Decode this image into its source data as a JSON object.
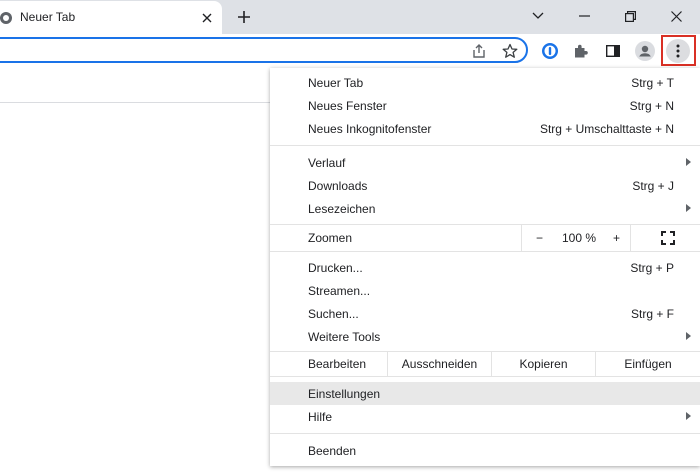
{
  "tab": {
    "title": "Neuer Tab"
  },
  "menu": {
    "items_group1": [
      {
        "label": "Neuer Tab",
        "shortcut": "Strg + T"
      },
      {
        "label": "Neues Fenster",
        "shortcut": "Strg + N"
      },
      {
        "label": "Neues Inkognitofenster",
        "shortcut": "Strg + Umschalttaste + N"
      }
    ],
    "items_group2": [
      {
        "label": "Verlauf",
        "shortcut": ""
      },
      {
        "label": "Downloads",
        "shortcut": "Strg + J"
      },
      {
        "label": "Lesezeichen",
        "shortcut": ""
      }
    ],
    "zoom": {
      "label": "Zoomen",
      "minus": "−",
      "value": "100 %",
      "plus": "+"
    },
    "items_group3": [
      {
        "label": "Drucken...",
        "shortcut": "Strg + P"
      },
      {
        "label": "Streamen...",
        "shortcut": ""
      },
      {
        "label": "Suchen...",
        "shortcut": "Strg + F"
      },
      {
        "label": "Weitere Tools",
        "shortcut": ""
      }
    ],
    "edit": {
      "label": "Bearbeiten",
      "cut": "Ausschneiden",
      "copy": "Kopieren",
      "paste": "Einfügen"
    },
    "items_group4": [
      {
        "label": "Einstellungen"
      },
      {
        "label": "Hilfe"
      }
    ],
    "exit": {
      "label": "Beenden"
    }
  },
  "colors": {
    "accent": "#1a73e8",
    "highlight_frame": "#d93025"
  }
}
